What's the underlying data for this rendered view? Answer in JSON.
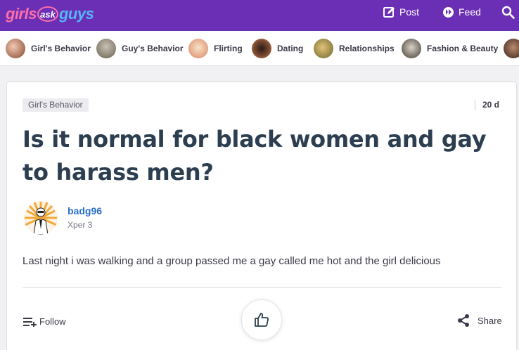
{
  "header": {
    "logo": {
      "part1": "girls",
      "part2": "ask",
      "part3": "guys"
    },
    "post_label": "Post",
    "feed_label": "Feed",
    "icons": {
      "post": "edit-icon",
      "feed": "feed-icon",
      "search": "search-icon"
    }
  },
  "categories": [
    {
      "label": "Girl's Behavior"
    },
    {
      "label": "Guy's Behavior"
    },
    {
      "label": "Flirting"
    },
    {
      "label": "Dating"
    },
    {
      "label": "Relationships"
    },
    {
      "label": "Fashion & Beauty"
    }
  ],
  "question": {
    "category": "Girl's Behavior",
    "age": "20 d",
    "title": "Is it normal for black women and gay to harass men?",
    "author": {
      "name": "badg96",
      "level": "Xper 3"
    },
    "body": "Last night i was walking and a group passed me a gay called me hot and the girl delicious"
  },
  "actions": {
    "follow_label": "Follow",
    "share_label": "Share",
    "like_icon": "thumbs-up-icon"
  },
  "colors": {
    "brand_purple": "#6b2fb5",
    "logo_pink": "#ff6fa8",
    "logo_blue": "#55b6f7",
    "link_blue": "#2a6fc9",
    "title_dark": "#2c3e50"
  }
}
